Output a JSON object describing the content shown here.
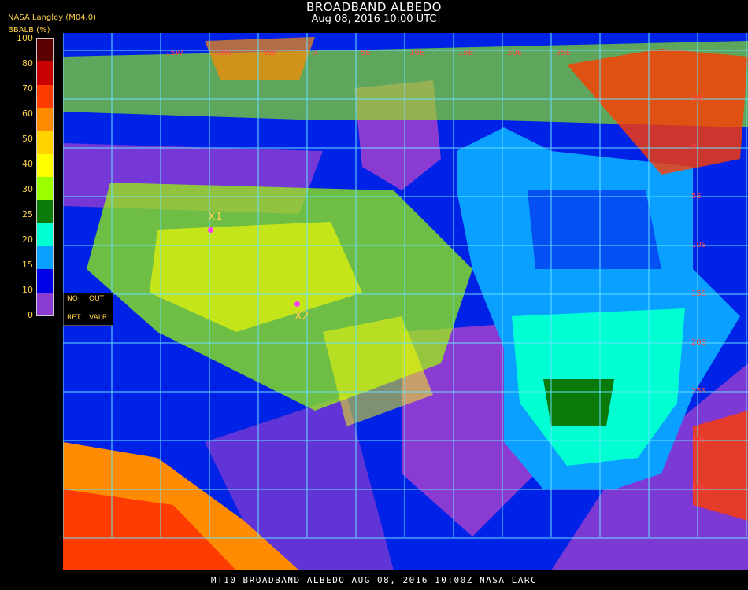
{
  "header": {
    "title": "BROADBAND ALBEDO",
    "subtitle": "Aug 08, 2016 10:00 UTC",
    "producer": "NASA Langley (M04.0)",
    "units": "BBALB (%)"
  },
  "colorbar": {
    "ticks": [
      "100",
      "80",
      "70",
      "60",
      "50",
      "40",
      "30",
      "25",
      "20",
      "15",
      "10",
      "0"
    ],
    "colors": [
      "#5a0000",
      "#c80000",
      "#ff3c00",
      "#ff8c00",
      "#ffd200",
      "#ffff00",
      "#9cff00",
      "#0a7a0a",
      "#00ffd2",
      "#0aa0ff",
      "#0000e6",
      "#8a3cd2"
    ]
  },
  "legend_box": {
    "no": "NO",
    "out": "OUT",
    "ret": "RET",
    "valr": "VALR"
  },
  "markers": [
    {
      "label": "X1"
    },
    {
      "label": "X2"
    }
  ],
  "grid": {
    "lon_labels": [
      "15W",
      "10W",
      "5W",
      "0",
      "5E",
      "10E",
      "15E",
      "20E",
      "25E"
    ],
    "lat_labels": [
      "5N",
      "0",
      "5S",
      "10S",
      "15S",
      "20S",
      "25S",
      "30S",
      "35S"
    ]
  },
  "footer": "MT10  BROADBAND ALBEDO   AUG 08, 2016 10:00Z   NASA LARC"
}
